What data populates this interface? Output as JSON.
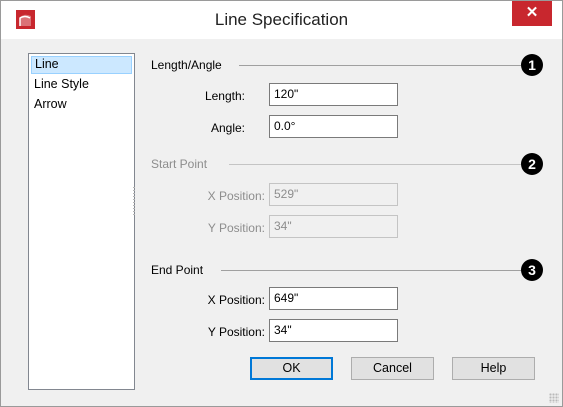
{
  "window": {
    "title": "Line Specification",
    "close_glyph": "✕",
    "app_icon": "chief-architect-logo-icon",
    "accent": "#c8272e"
  },
  "sidebar": {
    "items": [
      {
        "label": "Line",
        "selected": true
      },
      {
        "label": "Line Style",
        "selected": false
      },
      {
        "label": "Arrow",
        "selected": false
      }
    ]
  },
  "sections": {
    "length_angle": {
      "label": "Length/Angle",
      "badge": "1",
      "length_label": "Length:",
      "length_value": "120\"",
      "angle_label": "Angle:",
      "angle_value": "0.0°"
    },
    "start_point": {
      "label": "Start Point",
      "badge": "2",
      "x_label": "X Position:",
      "x_value": "529\"",
      "y_label": "Y Position:",
      "y_value": "34\"",
      "disabled": true
    },
    "end_point": {
      "label": "End Point",
      "badge": "3",
      "x_label": "X Position:",
      "x_value": "649\"",
      "y_label": "Y Position:",
      "y_value": "34\""
    }
  },
  "buttons": {
    "ok": "OK",
    "cancel": "Cancel",
    "help": "Help"
  }
}
